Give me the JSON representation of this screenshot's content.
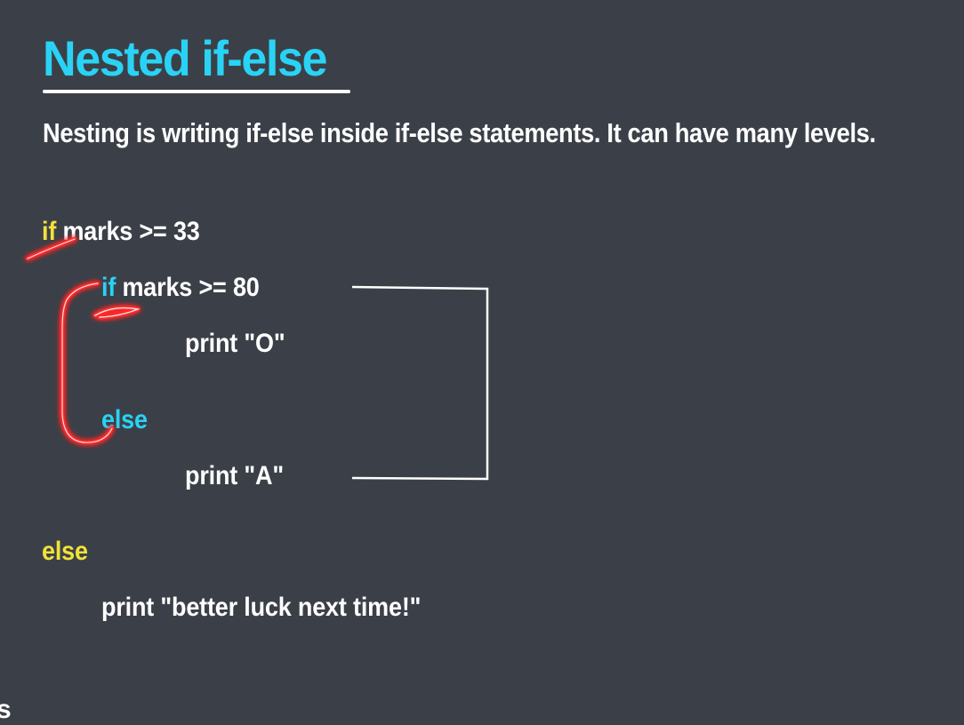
{
  "title": "Nested if-else",
  "subtitle": "Nesting is writing if-else inside if-else statements. It can have many levels.",
  "code": {
    "line1": {
      "keyword": "if",
      "rest": " marks >= 33"
    },
    "line2": {
      "keyword": "if",
      "rest": " marks >= 80"
    },
    "line3": {
      "text": "print \"O\""
    },
    "line4": {
      "keyword": "else"
    },
    "line5": {
      "text": "print \"A\""
    },
    "line6": {
      "keyword": "else"
    },
    "line7": {
      "text": "print \"better luck next time!\""
    }
  },
  "edge_glyph": "s",
  "colors": {
    "background": "#3b4048",
    "title": "#29d3f5",
    "outer_keyword": "#f2e13a",
    "inner_keyword": "#29d3f5",
    "annotation_red": "#ff1a1a"
  }
}
